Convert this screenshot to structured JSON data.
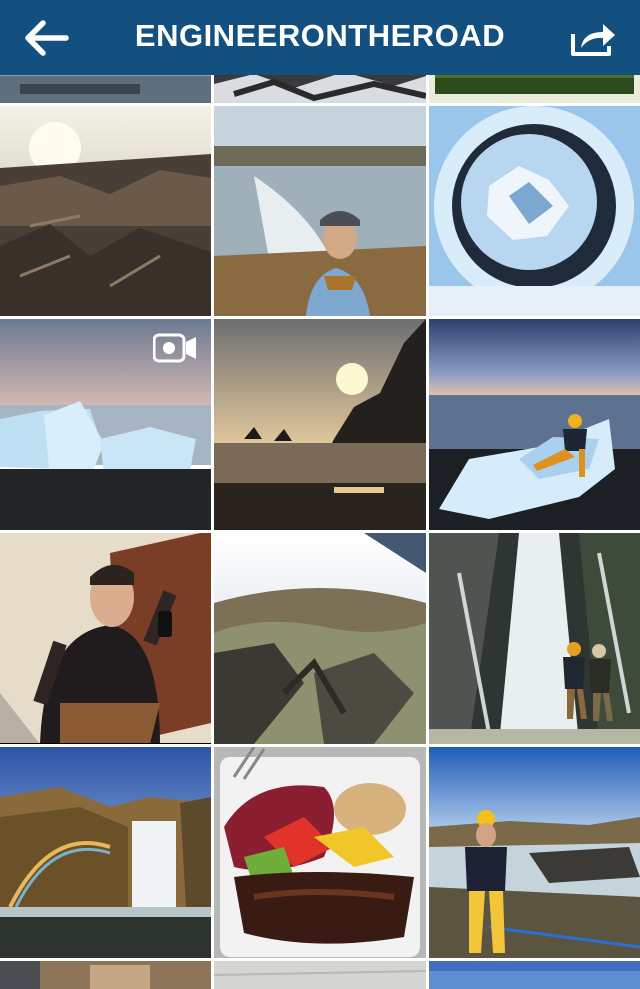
{
  "header": {
    "title": "ENGINEERONTHEROAD",
    "back_icon": "back-arrow-icon",
    "share_icon": "share-icon",
    "background_color": "#13507f"
  },
  "grid": {
    "columns": 3,
    "photos": [
      {
        "id": "row0-col0",
        "subject": "coastline at dusk (partially visible)"
      },
      {
        "id": "row0-col1",
        "subject": "snowy rocks (partially visible)"
      },
      {
        "id": "row0-col2",
        "subject": "green field (partially visible)"
      },
      {
        "id": "row1-col0",
        "subject": "rocky lava field with sun on horizon"
      },
      {
        "id": "row1-col1",
        "subject": "man in blue jacket and cap in front of waterfall canyon"
      },
      {
        "id": "row1-col2",
        "subject": "tiny-planet view of glacier ice"
      },
      {
        "id": "row2-col0",
        "subject": "icebergs on black sand beach",
        "media": "video"
      },
      {
        "id": "row2-col1",
        "subject": "sunset over sea stacks and cliff"
      },
      {
        "id": "row2-col2",
        "subject": "person in yellow hat sitting on iceberg"
      },
      {
        "id": "row3-col0",
        "subject": "mirror selfie of man in suspenders"
      },
      {
        "id": "row3-col1",
        "subject": "fisheye view of mossy lava field"
      },
      {
        "id": "row3-col2",
        "subject": "two people in front of waterfall"
      },
      {
        "id": "row4-col0",
        "subject": "waterfall with rainbow and cliffs"
      },
      {
        "id": "row4-col1",
        "subject": "plate with meat, red cabbage and vegetables"
      },
      {
        "id": "row4-col2",
        "subject": "man in yellow hat at river gorge"
      },
      {
        "id": "row5-col0",
        "subject": "interior (partially visible)"
      },
      {
        "id": "row5-col1",
        "subject": "floor tiles (partially visible)"
      },
      {
        "id": "row5-col2",
        "subject": "blue sky (partially visible)"
      }
    ],
    "video_icon": "video-camera-icon"
  }
}
